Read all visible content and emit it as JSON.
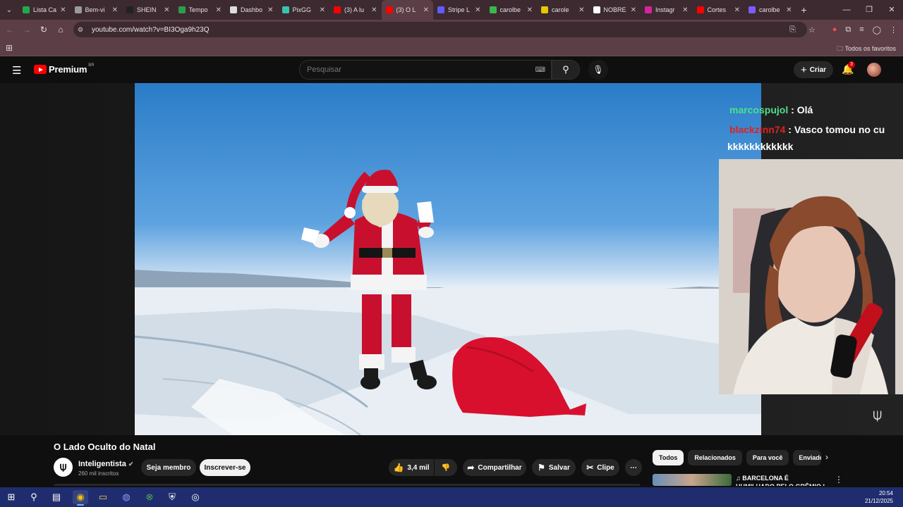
{
  "browser": {
    "tabs": [
      {
        "label": "Lista Ca",
        "color": "#22a84a"
      },
      {
        "label": "Bem-vi",
        "color": "#9a9a9a"
      },
      {
        "label": "SHEIN",
        "color": "#222222"
      },
      {
        "label": "Tempo",
        "color": "#2f9b4e"
      },
      {
        "label": "Dashbo",
        "color": "#dddddd"
      },
      {
        "label": "PixGG",
        "color": "#38c2b0"
      },
      {
        "label": "(3) A lu",
        "color": "#ff0000"
      },
      {
        "label": "(3) O L",
        "color": "#ff0000"
      },
      {
        "label": "Stripe L",
        "color": "#635bff"
      },
      {
        "label": "carolbe",
        "color": "#3ab94a"
      },
      {
        "label": "carole",
        "color": "#e6c800"
      },
      {
        "label": "NOBRE",
        "color": "#ffffff"
      },
      {
        "label": "Instagr",
        "color": "#d6249f"
      },
      {
        "label": "Cortes",
        "color": "#ff0000"
      },
      {
        "label": "carolbe",
        "color": "#7a5cff"
      }
    ],
    "active_tab": 7,
    "url": "youtube.com/watch?v=BI3Oga9h23Q",
    "bookmarks_label": "Todos os favoritos"
  },
  "youtube": {
    "logo_text": "Premium",
    "logo_region": "BR",
    "search_placeholder": "Pesquisar",
    "create_label": "Criar",
    "notification_count": "3"
  },
  "overlay": {
    "chat": [
      {
        "user": "marcospujol",
        "sep": " : ",
        "msg": "Olá"
      },
      {
        "user": "blackzinn74",
        "sep": " : ",
        "msg": "Vasco tomou no cu"
      }
    ],
    "chat_cont": "kkkkkkkkkkkk"
  },
  "video": {
    "title": "O Lado Oculto do Natal",
    "channel": "Inteligentista",
    "subscribers": "260 mil inscritos",
    "join_label": "Seja membro",
    "subscribe_label": "Inscrever-se",
    "likes": "3,4 mil",
    "share_label": "Compartilhar",
    "save_label": "Salvar",
    "clip_label": "Clipe"
  },
  "sidebar": {
    "chips": [
      "Todos",
      "Relacionados",
      "Para você",
      "Enviado"
    ],
    "rec_title": "♫ BARCELONA É HUMILHADO PELO GRÊMIO | Paródia A Mal"
  },
  "taskbar": {
    "time": "20:54",
    "date": "21/12/2025"
  },
  "colors": {
    "yt_red": "#ff0000",
    "chat_user1": "#4ee08a",
    "chat_user2": "#e02020",
    "taskbar": "#1f2d6e"
  }
}
